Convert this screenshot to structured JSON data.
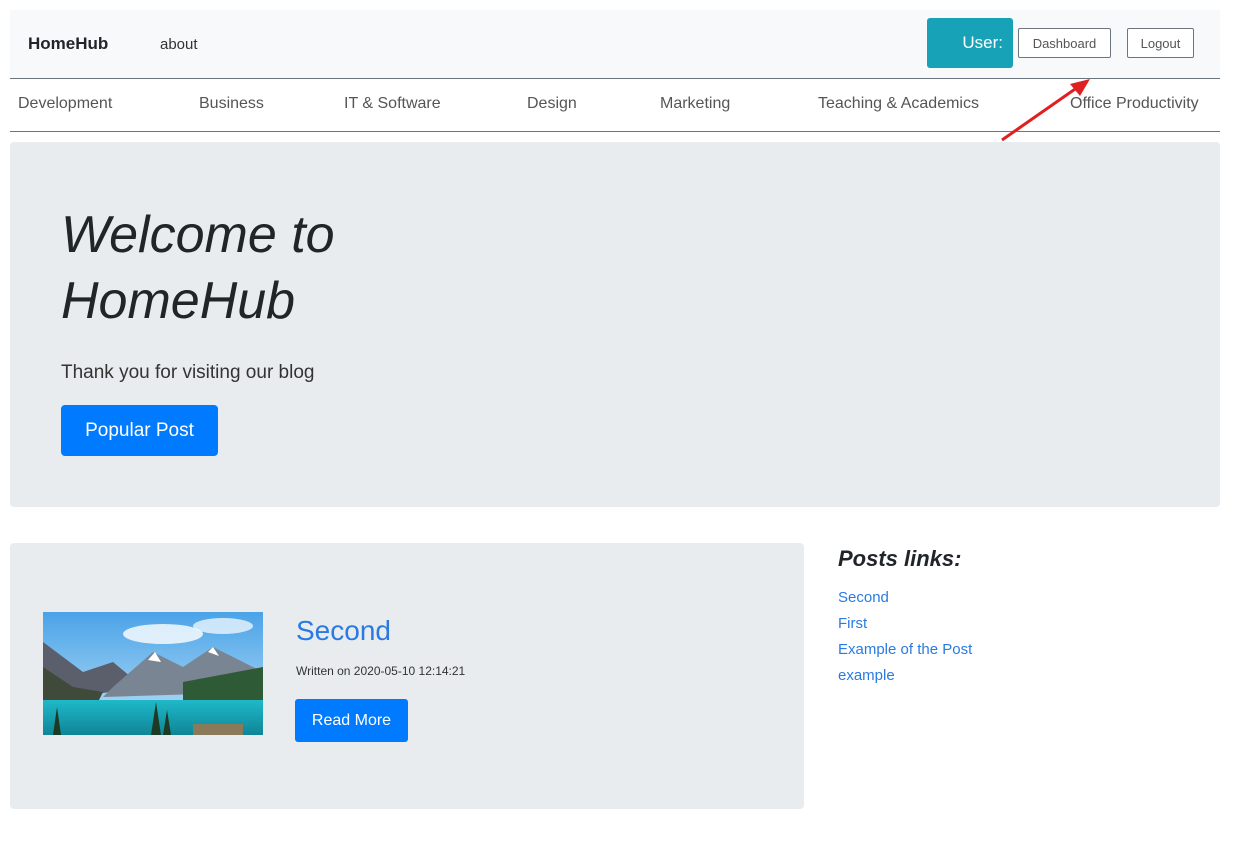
{
  "navbar": {
    "brand": "HomeHub",
    "about": "about",
    "user_label": "User:",
    "dashboard_label": "Dashboard",
    "logout_label": "Logout"
  },
  "categories": [
    "Development",
    "Business",
    "IT & Software",
    "Design",
    "Marketing",
    "Teaching & Academics",
    "Office Productivity"
  ],
  "hero": {
    "title": "Welcome to HomeHub",
    "subtitle": "Thank you for visiting our blog",
    "button": "Popular Post"
  },
  "post": {
    "title": "Second",
    "meta": "Written on 2020-05-10 12:14:21",
    "button": "Read More"
  },
  "sidebar": {
    "title": "Posts links:",
    "links": [
      "Second",
      "First",
      "Example of the Post",
      "example"
    ]
  },
  "colors": {
    "primary": "#007bff",
    "info": "#17a2b8",
    "jumbotron": "#e9ecef",
    "annotation_arrow": "#e02020"
  }
}
